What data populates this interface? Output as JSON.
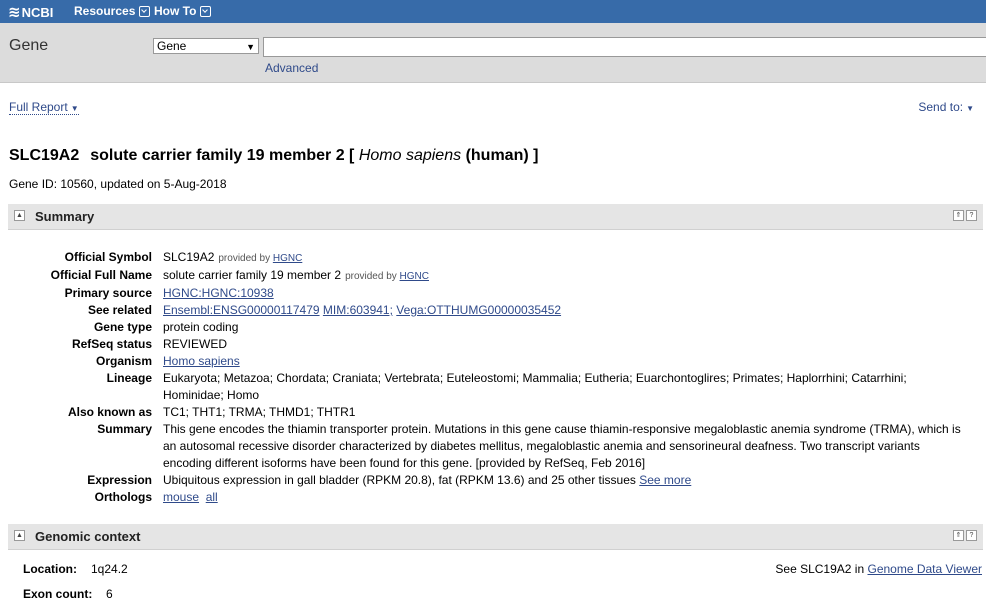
{
  "topbar": {
    "brand": "NCBI",
    "menu_resources": "Resources",
    "menu_howto": "How To"
  },
  "search": {
    "db_title": "Gene",
    "db_selected": "Gene",
    "query": "",
    "advanced": "Advanced"
  },
  "toolbar": {
    "full_report": "Full Report",
    "send_to": "Send to:"
  },
  "gene": {
    "symbol": "SLC19A2",
    "name": "solute carrier family 19 member 2 [",
    "species": "Homo sapiens",
    "species_common": "(human) ]",
    "id_line": "Gene ID: 10560, updated on 5-Aug-2018"
  },
  "summary_section": {
    "title": "Summary",
    "provided_by": "provided by",
    "hgnc": "HGNC",
    "rows": {
      "official_symbol": {
        "label": "Official Symbol",
        "value": "SLC19A2"
      },
      "official_full_name": {
        "label": "Official Full Name",
        "value": "solute carrier family 19 member 2"
      },
      "primary_source": {
        "label": "Primary source",
        "value": "HGNC:HGNC:10938"
      },
      "see_related": {
        "label": "See related",
        "links": [
          "Ensembl:ENSG00000117479",
          "MIM:603941;",
          "Vega:OTTHUMG00000035452"
        ]
      },
      "gene_type": {
        "label": "Gene type",
        "value": "protein coding"
      },
      "refseq_status": {
        "label": "RefSeq status",
        "value": "REVIEWED"
      },
      "organism": {
        "label": "Organism",
        "value": "Homo sapiens"
      },
      "lineage": {
        "label": "Lineage",
        "value": "Eukaryota; Metazoa; Chordata; Craniata; Vertebrata; Euteleostomi; Mammalia; Eutheria; Euarchontoglires; Primates; Haplorrhini; Catarrhini; Hominidae; Homo"
      },
      "aka": {
        "label": "Also known as",
        "value": "TC1; THT1; TRMA; THMD1; THTR1"
      },
      "summary": {
        "label": "Summary",
        "value": "This gene encodes the thiamin transporter protein. Mutations in this gene cause thiamin-responsive megaloblastic anemia syndrome (TRMA), which is an autosomal recessive disorder characterized by diabetes mellitus, megaloblastic anemia and sensorineural deafness. Two transcript variants encoding different isoforms have been found for this gene. [provided by RefSeq, Feb 2016]"
      },
      "expression": {
        "label": "Expression",
        "value": "Ubiquitous expression in gall bladder (RPKM 20.8), fat (RPKM 13.6) and 25 other tissues",
        "see_more": "See more"
      },
      "orthologs": {
        "label": "Orthologs",
        "mouse": "mouse",
        "all": "all"
      }
    }
  },
  "genomic_section": {
    "title": "Genomic context",
    "location_label": "Location:",
    "location": "1q24.2",
    "exon_label": "Exon count:",
    "exon_count": "6",
    "see_in": "See SLC19A2 in",
    "gdv_link": "Genome Data Viewer"
  }
}
